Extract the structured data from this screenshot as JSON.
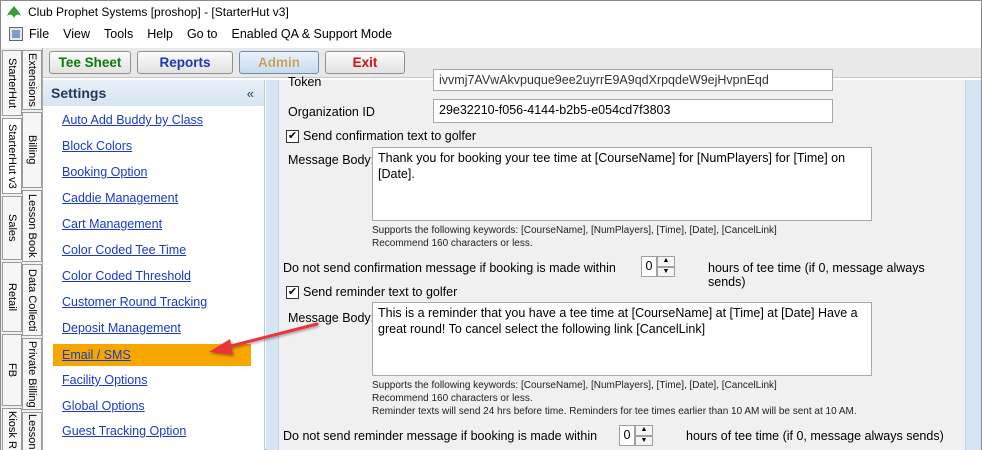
{
  "window": {
    "title": "Club Prophet Systems [proshop] - [StarterHut v3]"
  },
  "menu": {
    "items": [
      "File",
      "View",
      "Tools",
      "Help",
      "Go to",
      "Enabled QA & Support Mode"
    ]
  },
  "vertical_tabs": {
    "outer": [
      "StarterHut",
      "StarterHut v3",
      "Sales",
      "Retail",
      "FB",
      "Kiosk R"
    ],
    "inner": [
      "Extensions",
      "Billing",
      "Lesson Book",
      "Data Collecti",
      "Private Billing",
      "Lesson"
    ]
  },
  "toolbar": {
    "tee_sheet": "Tee Sheet",
    "reports": "Reports",
    "admin": "Admin",
    "exit": "Exit"
  },
  "settings": {
    "title": "Settings",
    "collapse": "«",
    "items": [
      "Auto Add Buddy by Class",
      "Block Colors",
      "Booking Option",
      "Caddie Management",
      "Cart Management",
      "Color Coded Tee Time",
      "Color Coded Threshold",
      "Customer Round Tracking",
      "Deposit Management",
      "Email / SMS",
      "Facility Options",
      "Global Options",
      "Guest Tracking Option"
    ],
    "active_item": "Email / SMS"
  },
  "form": {
    "token_label": "Token",
    "token_value": "ivvmj7AVwAkvpuque9ee2uyrrE9A9qdXrpqdeW9ejHvpnEqd",
    "org_label": "Organization ID",
    "org_value": "29e32210-f056-4144-b2b5-e054cd7f3803",
    "confirm_check_label": "Send confirmation text to golfer",
    "confirm_checked": true,
    "confirm_msg_label": "Message Body:",
    "confirm_msg_value": "Thank you for booking your tee time at [CourseName] for [NumPlayers] for [Time] on [Date].",
    "confirm_hint1": "Supports the following keywords: [CourseName], [NumPlayers], [Time], [Date], [CancelLink]",
    "confirm_hint2": "Recommend 160 characters or less.",
    "confirm_nosend_label": "Do not send confirmation message if booking is made within",
    "confirm_hours_value": "0",
    "confirm_hours_suffix": "hours of tee time (if 0, message always sends)",
    "reminder_check_label": "Send reminder text to golfer",
    "reminder_checked": true,
    "reminder_msg_label": "Message Body:",
    "reminder_msg_value": "This is a reminder that you have a tee time at [CourseName] at [Time] at [Date] Have a great round!   To cancel select the following link [CancelLink]",
    "reminder_hint1": "Supports the following keywords: [CourseName], [NumPlayers], [Time], [Date], [CancelLink]",
    "reminder_hint2": "Recommend 160 characters or less.",
    "reminder_hint3": "Reminder texts will send 24 hrs before time. Reminders for tee times earlier than 10 AM will be sent at 10 AM.",
    "reminder_nosend_label": "Do not send reminder message if booking is made within",
    "reminder_hours_value": "0",
    "reminder_hours_suffix": "hours of tee time (if 0, message always sends)"
  },
  "colors": {
    "highlight": "#f5a700",
    "arrow": "#e8363a",
    "link": "#1a3ac8",
    "panel_bg": "#d5e4f3"
  }
}
